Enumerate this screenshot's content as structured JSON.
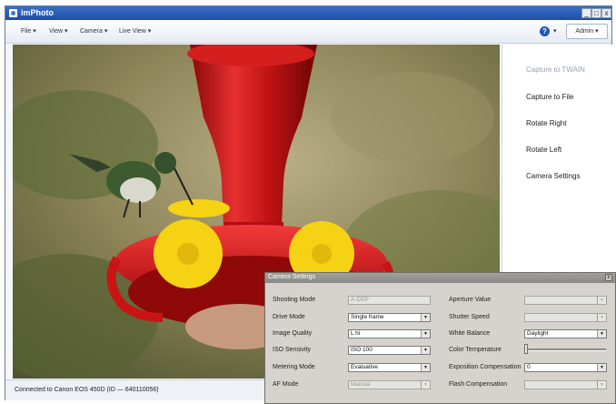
{
  "window": {
    "title": "imPhoto",
    "minimize": "_",
    "maximize": "□",
    "close": "x"
  },
  "menu": {
    "file": "File ▾",
    "view": "View ▾",
    "camera": "Camera ▾",
    "live_view": "Live View ▾",
    "help_caret": "▾",
    "admin": "Admin ▾"
  },
  "side_actions": [
    {
      "label": "Capture to TWAIN",
      "enabled": false
    },
    {
      "label": "Capture to File",
      "enabled": true
    },
    {
      "label": "Rotate Right",
      "enabled": true
    },
    {
      "label": "Rotate Left",
      "enabled": true
    },
    {
      "label": "Camera Settings",
      "enabled": true
    }
  ],
  "status": {
    "text": "Connected to Canon EOS 450D (ID — 640110056)"
  },
  "camera_settings": {
    "title": "Camera Settings",
    "close": "x",
    "left": [
      {
        "label": "Shooting Mode",
        "value": "A-DEP",
        "enabled": false,
        "dropdown": false
      },
      {
        "label": "Drive Mode",
        "value": "Single frame",
        "enabled": true,
        "dropdown": true
      },
      {
        "label": "Image Quality",
        "value": "L hi",
        "enabled": true,
        "dropdown": true
      },
      {
        "label": "ISO Sensivity",
        "value": "ISO 100",
        "enabled": true,
        "dropdown": true
      },
      {
        "label": "Metering Mode",
        "value": "Evaluative",
        "enabled": true,
        "dropdown": true
      },
      {
        "label": "AF Mode",
        "value": "Manual",
        "enabled": false,
        "dropdown": true
      }
    ],
    "right": [
      {
        "label": "Aperture Value",
        "value": "",
        "enabled": false
      },
      {
        "label": "Shutter Speed",
        "value": "",
        "enabled": false
      },
      {
        "label": "White Balance",
        "value": "Daylight",
        "enabled": true
      },
      {
        "label": "Color Temperature",
        "value": "",
        "enabled": true
      },
      {
        "label": "Exposition Compensation",
        "value": "0",
        "enabled": true
      },
      {
        "label": "Flash Compensation",
        "value": "",
        "enabled": false
      }
    ],
    "color_temperature_level": 0.0
  },
  "colors": {
    "title_blue": "#1d4fa8",
    "feeder_red": "#d41a1a",
    "flower_yellow": "#f5d213"
  }
}
